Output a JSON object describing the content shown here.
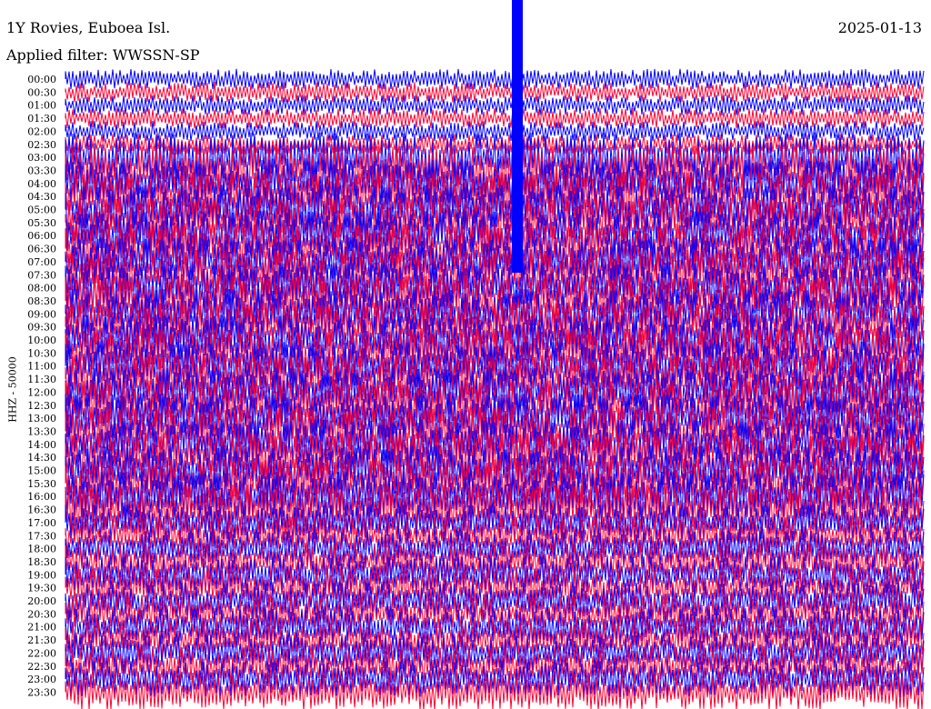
{
  "header": {
    "station": "1Y Rovies, Euboea Isl.",
    "date": "2025-01-13",
    "filter": "Applied filter: WWSSN-SP"
  },
  "chart_data": {
    "type": "line",
    "title": "1Y Rovies, Euboea Isl.",
    "subtitle": "Applied filter: WWSSN-SP",
    "ylabel": "HHZ - 50000",
    "xlabel": "",
    "grid": false,
    "row_labels": [
      "00:00",
      "00:30",
      "01:00",
      "01:30",
      "02:00",
      "02:30",
      "03:00",
      "03:30",
      "04:00",
      "04:30",
      "05:00",
      "05:30",
      "06:00",
      "06:30",
      "07:00",
      "07:30",
      "08:00",
      "08:30",
      "09:00",
      "09:30",
      "10:00",
      "10:30",
      "11:00",
      "11:30",
      "12:00",
      "12:30",
      "13:00",
      "13:30",
      "14:00",
      "14:30",
      "15:00",
      "15:30",
      "16:00",
      "16:30",
      "17:00",
      "17:30",
      "18:00",
      "18:30",
      "19:00",
      "19:30",
      "20:00",
      "20:30",
      "21:00",
      "21:30",
      "22:00",
      "22:30",
      "23:00",
      "23:30"
    ],
    "series_colors": [
      "#0000ff",
      "#ff0033"
    ]
  }
}
